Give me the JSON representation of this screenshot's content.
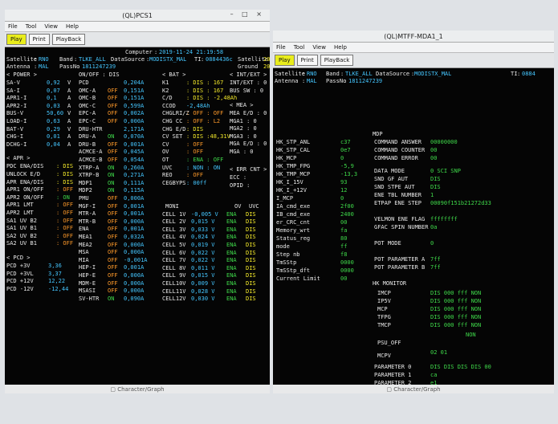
{
  "left_window": {
    "title": "(QL)PCS1",
    "win_buttons": "– □ ×",
    "menu": [
      "File",
      "Tool",
      "View",
      "Help"
    ],
    "toolbar": [
      "Play",
      "Print",
      "PlayBack"
    ],
    "info": {
      "computer_label": "Computer",
      "computer_value": "2019-11-24 21:19:58",
      "satellite_label": "Satellite",
      "satellite_value": "RNO",
      "band_label": "Band",
      "band_value": "TLKE_ALL",
      "datasource_label": "DataSource",
      "datasource_value": "MODISTX_MAL",
      "ti_label": "TI",
      "ti_value": "0884436c",
      "satellite2_label": "Satellite",
      "satellite2_value": "20",
      "antenna_label": "Antenna",
      "antenna_value": "MAL",
      "passno_label": "PassNo",
      "passno_value": "1811247239",
      "ground_label": "Ground",
      "ground_value": "20"
    },
    "power": {
      "header": "< POWER >",
      "rows": [
        {
          "label": "SA-V",
          "value": "0,92",
          "unit": "V"
        },
        {
          "label": "SA-I",
          "value": "0,07",
          "unit": "A"
        },
        {
          "label": "APR1-I",
          "value": "0,1",
          "unit": "A"
        },
        {
          "label": "APR2-I",
          "value": "0,03",
          "unit": "A"
        },
        {
          "label": "BUS-V",
          "value": "50,60",
          "unit": "V"
        },
        {
          "label": "LOAD-I",
          "value": "0,63",
          "unit": "A"
        },
        {
          "label": "BAT-V",
          "value": "0,29",
          "unit": "V"
        },
        {
          "label": "CHG-I",
          "value": "0,01",
          "unit": "A"
        },
        {
          "label": "DCHG-I",
          "value": "0,04",
          "unit": "A"
        }
      ]
    },
    "onoff": {
      "header": "ON/OFF : DIS",
      "rows": [
        {
          "label": "PCD",
          "state": "",
          "value": "0,204A"
        },
        {
          "label": "OMC-A",
          "state": "OFF",
          "value": "0,151A"
        },
        {
          "label": "OMC-B",
          "state": "OFF",
          "value": "0,151A"
        },
        {
          "label": "OMC-C",
          "state": "OFF",
          "value": "0,599A"
        },
        {
          "label": "EPC-A",
          "state": "OFF",
          "value": "0,002A"
        },
        {
          "label": "EPC-C",
          "state": "OFF",
          "value": "0,000A"
        },
        {
          "label": "DRU-HTR",
          "state": "",
          "value": "2,171A"
        },
        {
          "label": "DRU-A",
          "state": "ON",
          "value": "0,070A"
        },
        {
          "label": "DRU-B",
          "state": "OFF",
          "value": "0,001A"
        },
        {
          "label": "ACMCE-A",
          "state": "OFF",
          "value": "0,045A"
        },
        {
          "label": "ACMCE-B",
          "state": "OFF",
          "value": "0,054A"
        },
        {
          "label": "XTRP-A",
          "state": "ON",
          "value": "0,260A"
        },
        {
          "label": "XTRP-B",
          "state": "ON",
          "value": "0,271A"
        },
        {
          "label": "MDP1",
          "state": "ON",
          "value": "0,111A"
        },
        {
          "label": "MDP2",
          "state": "ON",
          "value": "0,115A"
        },
        {
          "label": "PMU",
          "state": "OFF",
          "value": "0,000A"
        },
        {
          "label": "MGF-I",
          "state": "OFF",
          "value": "0,001A"
        },
        {
          "label": "MTR-A",
          "state": "OFF",
          "value": "0,001A"
        },
        {
          "label": "MTR-B",
          "state": "OFF",
          "value": "0,000A"
        },
        {
          "label": "ENA",
          "state": "OFF",
          "value": "0,001A"
        },
        {
          "label": "MEA1",
          "state": "OFF",
          "value": "0,032A"
        },
        {
          "label": "MEA2",
          "state": "OFF",
          "value": "0,000A"
        },
        {
          "label": "MSA",
          "state": "OFF",
          "value": "0,000A"
        },
        {
          "label": "MIA",
          "state": "OFF",
          "value": "-0,001A"
        },
        {
          "label": "HEP-I",
          "state": "OFF",
          "value": "0,001A"
        },
        {
          "label": "HEP-E",
          "state": "OFF",
          "value": "0,000A"
        },
        {
          "label": "MDM-E",
          "state": "OFF",
          "value": "0,000A"
        },
        {
          "label": "MSASI",
          "state": "OFF",
          "value": "0,000A"
        },
        {
          "label": "SV-HTR",
          "state": "ON",
          "value": "0,090A"
        }
      ]
    },
    "bat": {
      "header": "< BAT >",
      "rows": [
        {
          "label": "K1",
          "value": ": DIS : 167"
        },
        {
          "label": "K2",
          "value": ": DIS : 167"
        },
        {
          "label": "C/D",
          "value": ": DIS : -2,48Ah"
        },
        {
          "label": "CCOD",
          "value": "-2,48Ah"
        },
        {
          "label": "CHGLRI/Z",
          "value": ": OFF : OFF"
        },
        {
          "label": "CHG CC",
          "value": ": OFF : L2"
        },
        {
          "label": "CHG E/D",
          "value": ": DIS"
        },
        {
          "label": "CV SET",
          "value": ": DIS :48,31V"
        },
        {
          "label": "CV",
          "value": ": OFF"
        },
        {
          "label": "OV",
          "value": ": OFF"
        },
        {
          "label": "OT",
          "value": ": ENA : OFF"
        },
        {
          "label": "UVC",
          "value": ": NON : ON"
        },
        {
          "label": "REO",
          "value": ": OFF"
        },
        {
          "label": "CEGBYPS",
          "value": ": 00ff"
        }
      ]
    },
    "intext": {
      "header": "< INT/EXT >",
      "rows": [
        "INT/EXT : 0",
        "BUS SW : 0"
      ]
    },
    "mea": {
      "header": "< MEA >",
      "rows": [
        "MEA E/D : 0",
        "MGA1 : 0",
        "MGA2 : 0",
        "MGA3 : 0",
        "MGA E/D : 0",
        "MGA : 0"
      ]
    },
    "err_cnt": {
      "header": "< ERR CNT >",
      "rows": [
        "ECC :",
        "OPID :"
      ]
    },
    "apr": {
      "header": "< APR >",
      "rows": [
        {
          "label": "PDC ENA/DIS",
          "value": ": DIS"
        },
        {
          "label": "UNLOCK E/D",
          "value": ": DIS"
        },
        {
          "label": "APR ENA/DIS",
          "value": ": DIS"
        },
        {
          "label": "APR1 ON/OFF",
          "value": ": OFF"
        },
        {
          "label": "APR2 ON/OFF",
          "value": ": ON"
        },
        {
          "label": "APR1 LMT",
          "value": ": OFF"
        },
        {
          "label": "APR2 LMT",
          "value": ": OFF"
        },
        {
          "label": "SA1 UV B2",
          "value": ": OFF"
        },
        {
          "label": "SA1 UV B1",
          "value": ": OFF"
        },
        {
          "label": "SA2 UV B2",
          "value": ": OFF"
        },
        {
          "label": "SA2 UV B1",
          "value": ": OFF"
        }
      ]
    },
    "pcd": {
      "header": "< PCD >",
      "rows": [
        {
          "label": "PCD +3V",
          "value": "3,36"
        },
        {
          "label": "PCD +3VL",
          "value": "3,37"
        },
        {
          "label": "PCD +12V",
          "value": "12,22"
        },
        {
          "label": "PCD -12V",
          "value": "-12,44"
        }
      ]
    },
    "cells": {
      "headers": [
        "MONI",
        "OV",
        "UVC"
      ],
      "rows": [
        {
          "label": "CELL 1V",
          "value": "-0,005 V",
          "ov": "ENA",
          "uvc": "DIS"
        },
        {
          "label": "CELL 2V",
          "value": "0,015 V",
          "ov": "ENA",
          "uvc": "DIS"
        },
        {
          "label": "CELL 3V",
          "value": "0,033 V",
          "ov": "ENA",
          "uvc": "DIS"
        },
        {
          "label": "CELL 4V",
          "value": "0,024 V",
          "ov": "ENA",
          "uvc": "DIS"
        },
        {
          "label": "CELL 5V",
          "value": "0,019 V",
          "ov": "ENA",
          "uvc": "DIS"
        },
        {
          "label": "CELL 6V",
          "value": "0,022 V",
          "ov": "ENA",
          "uvc": "DIS"
        },
        {
          "label": "CELL 7V",
          "value": "0,022 V",
          "ov": "ENA",
          "uvc": "DIS"
        },
        {
          "label": "CELL 8V",
          "value": "0,011 V",
          "ov": "ENA",
          "uvc": "DIS"
        },
        {
          "label": "CELL 9V",
          "value": "0,015 V",
          "ov": "ENA",
          "uvc": "DIS"
        },
        {
          "label": "CELL10V",
          "value": "0,009 V",
          "ov": "ENA",
          "uvc": "DIS"
        },
        {
          "label": "CELL11V",
          "value": "0,028 V",
          "ov": "ENA",
          "uvc": "DIS"
        },
        {
          "label": "CELL12V",
          "value": "0,030 V",
          "ov": "ENA",
          "uvc": "DIS"
        }
      ]
    },
    "statusbar": "Character/Graph"
  },
  "right_window": {
    "title": "(QL)MTFF-MDA1_1",
    "menu": [
      "File",
      "Tool",
      "View",
      "Help"
    ],
    "toolbar": [
      "Play",
      "Print",
      "PlayBack"
    ],
    "info": {
      "satellite_label": "Satellite",
      "satellite_value": "RNO",
      "band_label": "Band",
      "band_value": "TLKE_ALL",
      "datasource_label": "DataSource",
      "datasource_value": "MODISTX_MAL",
      "ti_label": "TI",
      "ti_value": "0884",
      "antenna_label": "Antenna",
      "antenna_value": "MAL",
      "passno_label": "PassNo",
      "passno_value": "1811247239"
    },
    "hk": [
      {
        "label": "HK_STP_ANL",
        "value": "c37"
      },
      {
        "label": "HK_STP_CAL",
        "value": "0e7"
      },
      {
        "label": "HK_MCP",
        "value": "0"
      },
      {
        "label": "HK_TMP_FPG",
        "value": "-5,9"
      },
      {
        "label": "HK_TMP_MCP",
        "value": "-13,3"
      },
      {
        "label": "HK_I_15V",
        "value": "93"
      },
      {
        "label": "HK_I_+12V",
        "value": "12"
      },
      {
        "label": "I_MCP",
        "value": "0"
      },
      {
        "label": "IA_cmd_exe",
        "value": "2f00"
      },
      {
        "label": "IB_cmd_exe",
        "value": "2400"
      },
      {
        "label": "er_CRC_cnt",
        "value": "00"
      },
      {
        "label": "Memory_wrt",
        "value": "fa"
      },
      {
        "label": "Status_reg",
        "value": "80"
      },
      {
        "label": "mode",
        "value": "ff"
      },
      {
        "label": "Step nb",
        "value": "f8"
      },
      {
        "label": "TmSStp",
        "value": "0000"
      },
      {
        "label": "TmSStp_dft",
        "value": "0000"
      },
      {
        "label": "Current Limit",
        "value": "00"
      }
    ],
    "mdp": {
      "header": "MDP",
      "rows": [
        {
          "label": "COMMAND ANSWER",
          "value": "00000000"
        },
        {
          "label": "COMMAND COUNTER",
          "value": "00"
        },
        {
          "label": "COMMAND ERROR",
          "value": "00"
        },
        {
          "label": "DATA MODE",
          "value": "0 SCI SNP"
        },
        {
          "label": "SND GF AUT",
          "value": "DIS"
        },
        {
          "label": "SND STPE AUT",
          "value": "DIS"
        },
        {
          "label": "ENE TBL NUMBER",
          "value": "1"
        },
        {
          "label": "ETPAP ENE STEP",
          "value": "00090f151b21272d33"
        },
        {
          "label": "VELMON ENE FLAG",
          "value": "ffffffff"
        },
        {
          "label": "GFAC SPIN NUMBER",
          "value": "0a"
        },
        {
          "label": "POT MODE",
          "value": "0"
        },
        {
          "label": "POT PARAMETER A",
          "value": "7ff"
        },
        {
          "label": "POT PARAMETER B",
          "value": "7ff"
        }
      ]
    },
    "hk_monitor": {
      "header": "HK MONITOR",
      "rows": [
        {
          "label": "IMCP",
          "value": "DIS 000 fff NON"
        },
        {
          "label": "IP5V",
          "value": "DIS 000 fff NON"
        },
        {
          "label": "MCP",
          "value": "DIS 000 fff NON"
        },
        {
          "label": "TFPG",
          "value": "DIS 000 fff NON"
        },
        {
          "label": "TMCP",
          "value": "DIS 000 fff NON"
        }
      ],
      "psu_label": "PSU_OFF",
      "psu_value": "NON",
      "mcpv_label": "MCPV",
      "mcpv_value": "02 01",
      "params": [
        {
          "label": "PARAMETER 0",
          "value": "DIS DIS DIS DIS 00"
        },
        {
          "label": "PARAMETER 1",
          "value": "ca"
        },
        {
          "label": "PARAMETER 2",
          "value": "e1"
        }
      ]
    },
    "statusbar": "Character/Graph"
  },
  "colors": {
    "background": "#050505",
    "label": "#e8e8e8",
    "value_cyan": "#45c6ff",
    "value_yellow": "#f2e82a",
    "value_green": "#3fd94a",
    "value_orange": "#ff9a2a",
    "toolbar_active": "#e9ed1c"
  }
}
